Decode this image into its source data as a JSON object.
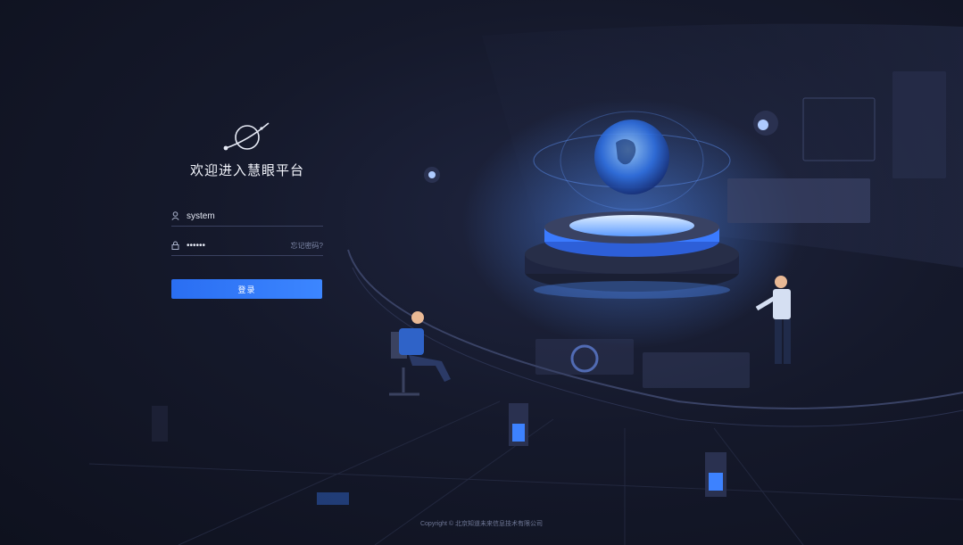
{
  "brand": {
    "title": "欢迎进入慧眼平台",
    "logo_icon": "planet-logo-icon"
  },
  "login_form": {
    "username_icon": "user-icon",
    "username_value": "system",
    "password_icon": "lock-icon",
    "password_value": "system",
    "forgot_label": "忘记密码?",
    "submit_label": "登录"
  },
  "footer": {
    "copyright": "Copyright © 北京知道未来信息技术有限公司"
  },
  "colors": {
    "accent": "#2f78f6",
    "background": "#15192b",
    "text": "#e6eaf5"
  }
}
